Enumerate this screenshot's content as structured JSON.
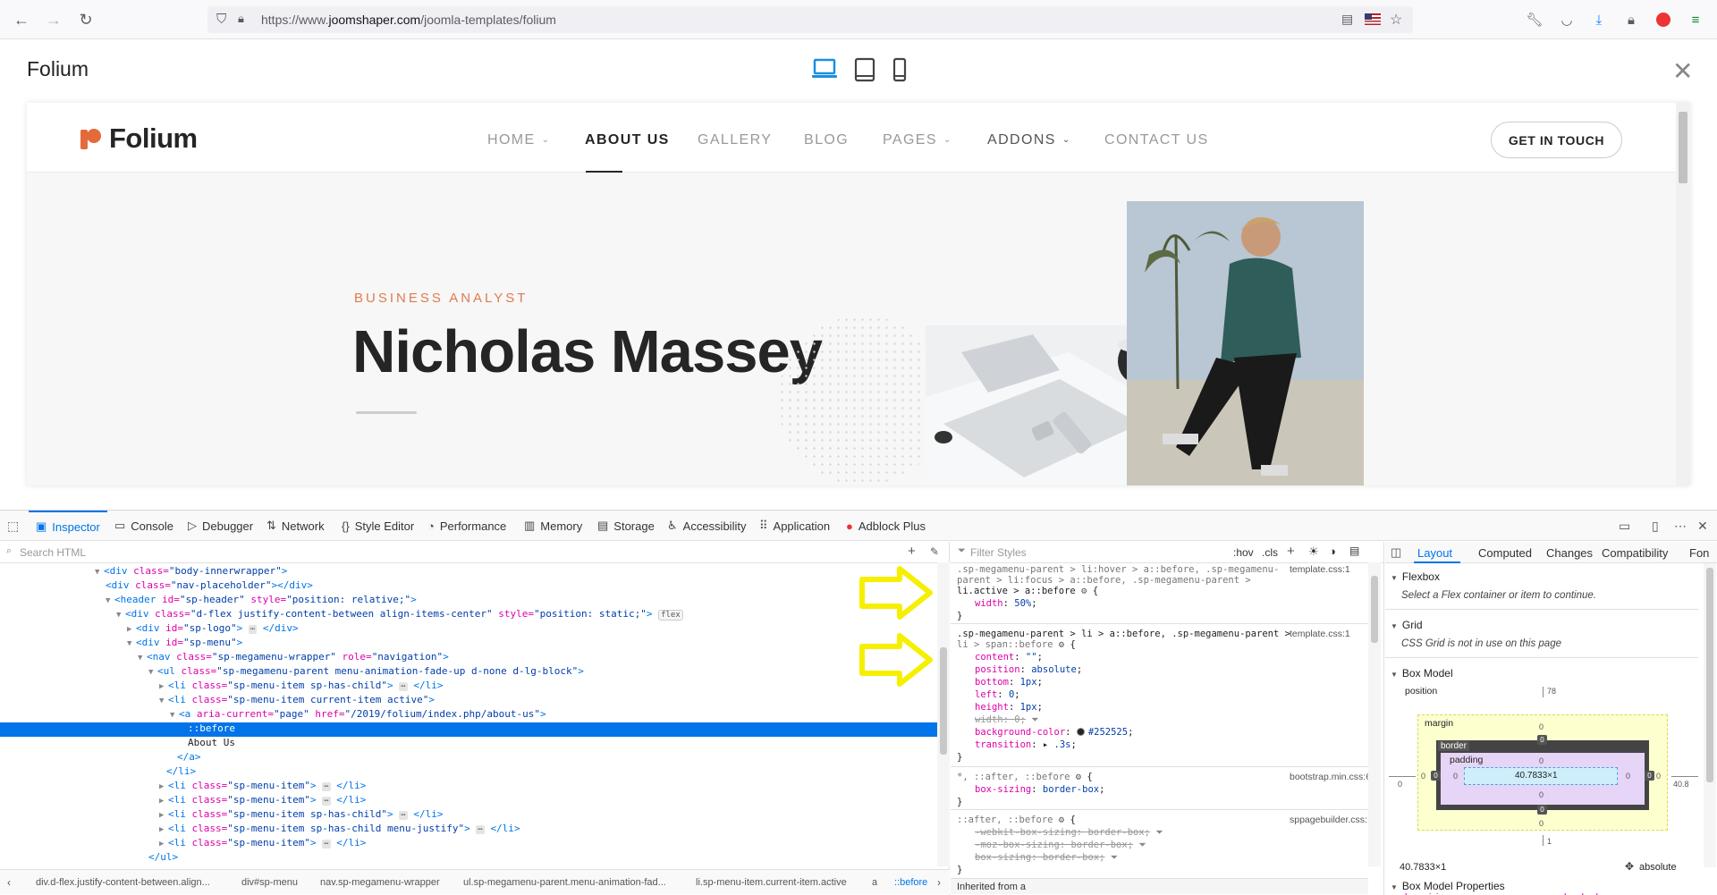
{
  "browser": {
    "url_prefix": "https://www.",
    "url_domain": "joomshaper.com",
    "url_path": "/joomla-templates/folium"
  },
  "preview": {
    "title": "Folium",
    "close_glyph": "✕"
  },
  "site": {
    "logo_text": "Folium",
    "menu": [
      {
        "label": "HOME",
        "dropdown": true
      },
      {
        "label": "ABOUT US",
        "dropdown": false,
        "active": true
      },
      {
        "label": "GALLERY",
        "dropdown": false
      },
      {
        "label": "BLOG",
        "dropdown": false
      },
      {
        "label": "PAGES",
        "dropdown": true
      },
      {
        "label": "ADDONS",
        "dropdown": true
      },
      {
        "label": "CONTACT US",
        "dropdown": false
      }
    ],
    "cta": "GET IN TOUCH",
    "hero_eyebrow": "BUSINESS ANALYST",
    "hero_name": "Nicholas Massey"
  },
  "devtools": {
    "tabs": [
      "Inspector",
      "Console",
      "Debugger",
      "Network",
      "Style Editor",
      "Performance",
      "Memory",
      "Storage",
      "Accessibility",
      "Application",
      "Adblock Plus"
    ],
    "search_placeholder": "Search HTML",
    "filter_placeholder": "Filter Styles",
    "hov": ":hov",
    "cls": ".cls",
    "tree": [
      "<div class=\"body-innerwrapper\">",
      "<div class=\"nav-placeholder\"></div>",
      "<header id=\"sp-header\" style=\"position: relative;\">",
      "<div class=\"d-flex justify-content-between align-items-center\" style=\"position: static;\">",
      "<div id=\"sp-logo\"> </div>",
      "<div id=\"sp-menu\">",
      "<nav class=\"sp-megamenu-wrapper\" role=\"navigation\">",
      "<ul class=\"sp-megamenu-parent menu-animation-fade-up d-none d-lg-block\">",
      "<li class=\"sp-menu-item sp-has-child\"> </li>",
      "<li class=\"sp-menu-item current-item active\">",
      "<a aria-current=\"page\" href=\"/2019/folium/index.php/about-us\">",
      "::before",
      "About Us",
      "</a>",
      "</li>",
      "<li class=\"sp-menu-item\"> </li>",
      "<li class=\"sp-menu-item\"> </li>",
      "<li class=\"sp-menu-item sp-has-child\"> </li>",
      "<li class=\"sp-menu-item sp-has-child menu-justify\"> </li>",
      "<li class=\"sp-menu-item\"> </li>",
      "</ul>"
    ],
    "breadcrumbs": [
      "div.d-flex.justify-content-between.align...",
      "div#sp-menu",
      "nav.sp-megamenu-wrapper",
      "ul.sp-megamenu-parent.menu-animation-fad...",
      "li.sp-menu-item.current-item.active",
      "a",
      "::before"
    ],
    "rules": {
      "r1_sel_a": ".sp-megamenu-parent > li:hover > a::before, .sp-megamenu-",
      "r1_sel_b": "parent > li:focus > a::before, .sp-megamenu-parent >",
      "r1_sel_c": "li.active > a::before",
      "r1_src": "template.css:1",
      "r1_p1": "width",
      "r1_v1": "50%",
      "r2_sel_a": ".sp-megamenu-parent > li > a::before, .sp-megamenu-parent >",
      "r2_sel_b": "li > span::before",
      "r2_src": "template.css:1",
      "r2_props": [
        [
          "content",
          "\"\""
        ],
        [
          "position",
          "absolute"
        ],
        [
          "bottom",
          "1px"
        ],
        [
          "left",
          "0"
        ],
        [
          "height",
          "1px"
        ],
        [
          "width",
          "0"
        ],
        [
          "background-color",
          "#252525"
        ],
        [
          "transition",
          ".3s"
        ]
      ],
      "r3_sel": "*, ::after, ::before",
      "r3_src": "bootstrap.min.css:6",
      "r3_p": "box-sizing",
      "r3_v": "border-box",
      "r4_sel": "::after, ::before",
      "r4_src": "sppagebuilder.css:1",
      "r4_props": [
        [
          "-webkit-box-sizing",
          "border-box"
        ],
        [
          "-moz-box-sizing",
          "border-box"
        ],
        [
          "box-sizing",
          "border-box"
        ]
      ],
      "inherited": "Inherited from a"
    },
    "layout": {
      "tabs": [
        "Layout",
        "Computed",
        "Changes",
        "Compatibility",
        "Fon"
      ],
      "flexbox": "Flexbox",
      "flexbox_note": "Select a Flex container or item to continue.",
      "grid": "Grid",
      "grid_note": "CSS Grid is not in use on this page",
      "box_model": "Box Model",
      "position_label": "position",
      "position_top": "78",
      "margin_label": "margin",
      "border_label": "border",
      "padding_label": "padding",
      "content_size": "40.7833×1",
      "left_outer": "0",
      "right_outer": "40.8",
      "bottom_outer": "1",
      "zero": "0",
      "footer_size": "40.7833×1",
      "footer_position": "absolute",
      "box_model_props": "Box Model Properties",
      "box_sizing_prop": "box-sizing",
      "box_sizing_val": "border-box"
    }
  }
}
